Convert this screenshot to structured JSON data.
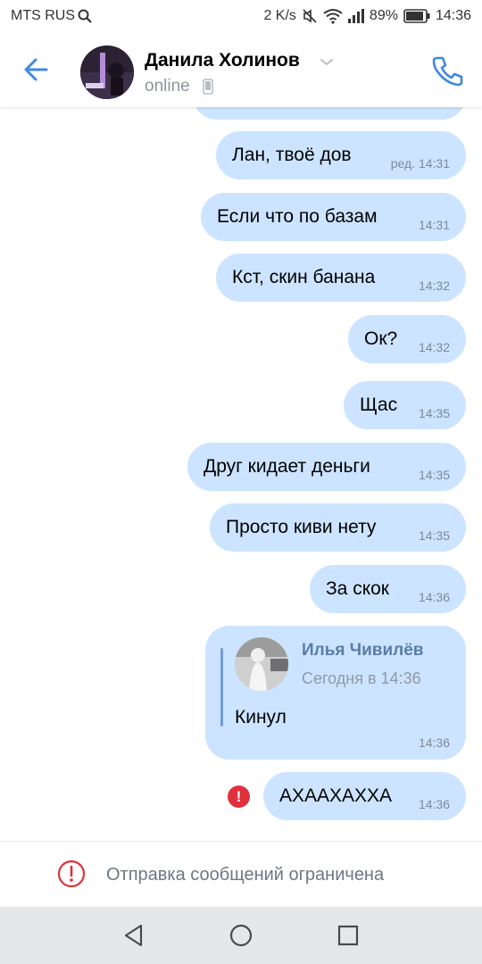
{
  "status_bar": {
    "carrier": "MTS RUS",
    "speed": "2 K/s",
    "battery": "89%",
    "time": "14:36",
    "icons": [
      "search-icon",
      "mute-icon",
      "wifi-icon",
      "signal-icon",
      "battery-icon"
    ]
  },
  "header": {
    "contact_name": "Данила Холинов",
    "status": "online",
    "icons": [
      "back-arrow-icon",
      "chevron-down-icon",
      "mobile-device-icon",
      "phone-icon"
    ]
  },
  "messages": [
    {
      "text": "Лан, твоё дов",
      "time": "ред. 14:31"
    },
    {
      "text": "Если что по базам",
      "time": "14:31"
    },
    {
      "text": "Кст, скин банана",
      "time": "14:32"
    },
    {
      "text": "Ок?",
      "time": "14:32"
    },
    {
      "text": "Щас",
      "time": "14:35"
    },
    {
      "text": "Друг кидает деньги",
      "time": "14:35"
    },
    {
      "text": "Просто киви нету",
      "time": "14:35"
    },
    {
      "text": "За скок",
      "time": "14:36"
    }
  ],
  "forwarded": {
    "author": "Илья Чивилёв",
    "date": "Сегодня в 14:36",
    "text": "Кинул",
    "time": "14:36"
  },
  "failed_message": {
    "text": "АХААХАХХА",
    "time": "14:36",
    "error_icon": "!"
  },
  "restriction": {
    "text": "Отправка сообщений ограничена",
    "icon": "alert-circle-icon"
  },
  "colors": {
    "accent": "#3f8ae0",
    "bubble": "#cce4ff",
    "error": "#e0303c"
  }
}
